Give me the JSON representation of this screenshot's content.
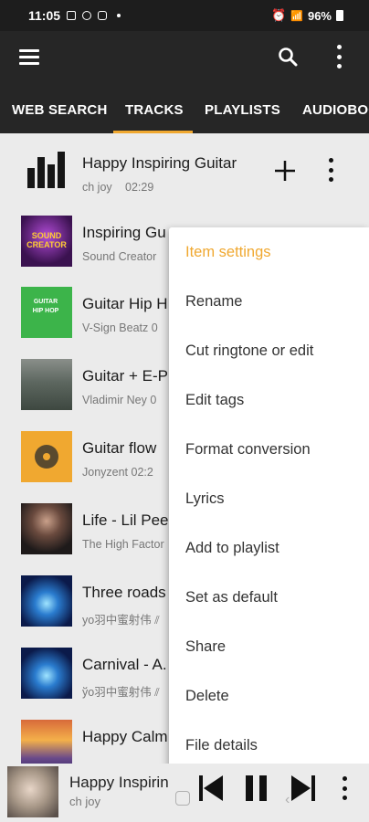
{
  "status_bar": {
    "time": "11:05",
    "battery": "96%"
  },
  "tabs": [
    "WEB SEARCH",
    "TRACKS",
    "PLAYLISTS",
    "AUDIOBOO"
  ],
  "now_playing_row": {
    "title": "Happy Inspiring Guitar",
    "artist": "ch joy",
    "duration": "02:29"
  },
  "tracks": [
    {
      "title": "Inspiring Gu",
      "artist": "Sound Creator",
      "art_text": "SOUND CREATOR"
    },
    {
      "title": "Guitar Hip H",
      "artist": "V-Sign Beatz  0",
      "art_text": "GUITAR HIP HOP"
    },
    {
      "title": "Guitar + E-P",
      "artist": "Vladimir Ney  0",
      "art_text": ""
    },
    {
      "title": "Guitar flow",
      "artist": "Jonyzent  02:2",
      "art_text": ""
    },
    {
      "title": "Life - Lil Pee",
      "artist": "The High Factor",
      "art_text": ""
    },
    {
      "title": "Three roads",
      "artist": "yo羽中蜜射伟 ⫽",
      "art_text": ""
    },
    {
      "title": "Carnival - A.",
      "artist": "ўo羽中蜜射伟 ⫽",
      "art_text": ""
    },
    {
      "title": "Happy Calm",
      "artist": "",
      "art_text": ""
    }
  ],
  "context_menu": {
    "header": "Item settings",
    "items": [
      "Rename",
      "Cut ringtone or edit",
      "Edit tags",
      "Format conversion",
      "Lyrics",
      "Add to playlist",
      "Set as default",
      "Share",
      "Delete",
      "File details"
    ]
  },
  "player": {
    "title": "Happy Inspirin",
    "artist": "ch joy"
  },
  "colors": {
    "accent": "#f0a830",
    "toolbar": "#262626",
    "list_bg": "#ebebeb",
    "menu_bg": "#ffffff"
  }
}
